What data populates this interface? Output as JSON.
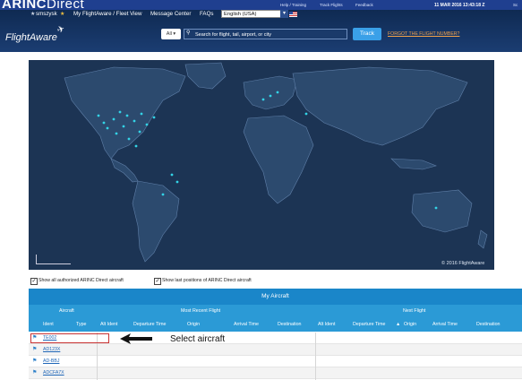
{
  "top_bar": {
    "logo_main": "ARINC",
    "logo_sub": "Direct",
    "links": [
      "Help / Training",
      "Track Flights",
      "Feedback"
    ],
    "datetime": "11 MAR 2016 13:43:18 Z",
    "user_short": "Sc"
  },
  "fa_header": {
    "username": "smszysk",
    "nav": [
      "My FlightAware / Fleet View",
      "Message Center",
      "FAQs"
    ],
    "language": "English (USA)",
    "logo": "FlightAware",
    "search_scope": "All",
    "search_placeholder": "Search for flight, tail, airport, or city",
    "track_label": "Track",
    "forgot_label": "FORGOT THE FLIGHT NUMBER?"
  },
  "map": {
    "copyright": "© 2016 FlightAware",
    "ocean_color": "#1c3454",
    "land_color": "#2c4a6e",
    "marker_color": "#33d3e6"
  },
  "options": {
    "show_all_label": "Show all authorized ARINC Direct aircraft",
    "show_all_checked": true,
    "show_last_label": "Show last positions of ARINC Direct aircraft",
    "show_last_checked": true
  },
  "table": {
    "title": "My Aircraft",
    "groups": [
      "Aircraft",
      "Most Recent Flight",
      "Next Flight"
    ],
    "columns": [
      "Ident",
      "Type",
      "Alt Ident",
      "Departure Time",
      "Origin",
      "Arrival Time",
      "Destination",
      "Alt Ident",
      "Departure Time",
      "Origin",
      "Arrival Time",
      "Destination"
    ],
    "rows": [
      {
        "ident": "TE002"
      },
      {
        "ident": "AD123X"
      },
      {
        "ident": "AD-BBJ"
      },
      {
        "ident": "ADCFA7X"
      }
    ]
  },
  "annotation": {
    "text": "Select aircraft"
  }
}
